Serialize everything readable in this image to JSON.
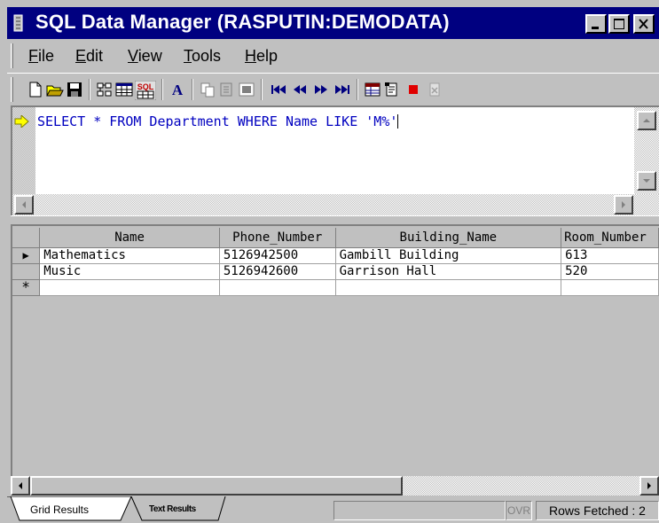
{
  "window": {
    "title": "SQL Data Manager (RASPUTIN:DEMODATA)"
  },
  "menu": {
    "items": [
      {
        "label": "File",
        "accel": "F",
        "rest": "ile"
      },
      {
        "label": "Edit",
        "accel": "E",
        "rest": "dit"
      },
      {
        "label": "View",
        "accel": "V",
        "rest": "iew"
      },
      {
        "label": "Tools",
        "accel": "T",
        "rest": "ools"
      },
      {
        "label": "Help",
        "accel": "H",
        "rest": "elp"
      }
    ]
  },
  "toolbar": {
    "icons": [
      "new-file-icon",
      "open-folder-icon",
      "save-icon",
      "table-tree-icon",
      "grid-view-icon",
      "sql-mode-icon",
      "font-icon",
      "copy-icon",
      "paste-icon",
      "run-query-icon",
      "first-record-icon",
      "previous-record-icon",
      "next-record-icon",
      "last-record-icon",
      "table-design-icon",
      "clear-icon",
      "stop-icon",
      "export-icon"
    ],
    "sql_icon_text": "SQL",
    "font_icon_text": "A"
  },
  "editor": {
    "sql": "SELECT * FROM Department WHERE Name LIKE 'M%'"
  },
  "grid": {
    "columns": [
      "Name",
      "Phone_Number",
      "Building_Name",
      "Room_Number"
    ],
    "rows": [
      {
        "name": "Mathematics",
        "phone": "5126942500",
        "building": "Gambill Building",
        "room": "613"
      },
      {
        "name": "Music",
        "phone": "5126942600",
        "building": "Garrison Hall",
        "room": "520"
      }
    ],
    "current_row_marker": "▶",
    "new_row_marker": "*"
  },
  "status": {
    "tabs": [
      {
        "label": "Grid Results",
        "active": true
      },
      {
        "label": "Text Results",
        "active": false
      }
    ],
    "ovr": "OVR",
    "rows_fetched": "Rows Fetched : 2"
  }
}
